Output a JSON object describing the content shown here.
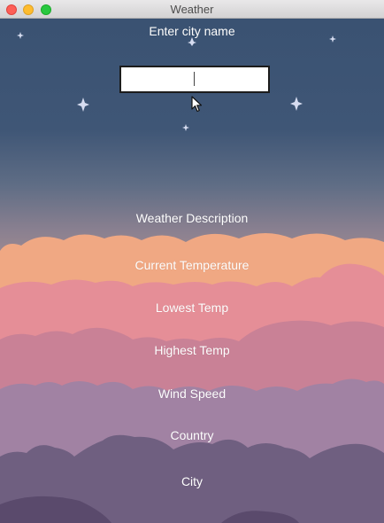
{
  "window": {
    "title": "Weather",
    "controls": [
      "close",
      "minimize",
      "maximize"
    ]
  },
  "search": {
    "prompt": "Enter city name",
    "value": "",
    "placeholder": ""
  },
  "fields": {
    "description": "Weather Description",
    "current_temp": "Current Temperature",
    "lowest_temp": "Lowest Temp",
    "highest_temp": "Highest Temp",
    "wind_speed": "Wind Speed",
    "country": "Country",
    "city": "City"
  },
  "colors": {
    "sky_top": "#3a5272",
    "sky_mid": "#5f6d85",
    "sky_horizon": "#9a8a8f",
    "cloud_orange": "#f0a883",
    "cloud_pink": "#e58e97",
    "cloud_rose": "#c98196",
    "cloud_mauve": "#a182a3",
    "cloud_purple": "#6f5f80",
    "cloud_dark": "#5a4a6c",
    "star": "#d6dcf0"
  },
  "icons": [
    "star-icon",
    "sparkle-icon",
    "mouse-cursor-icon"
  ]
}
